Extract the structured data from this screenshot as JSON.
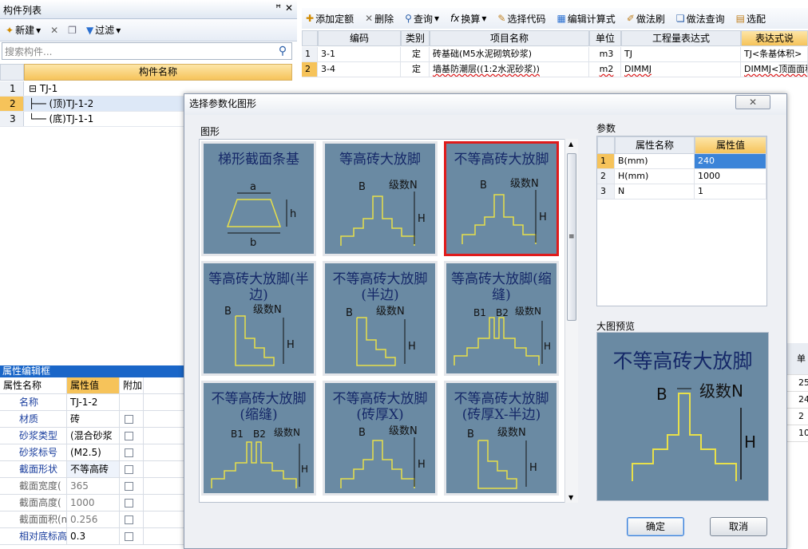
{
  "left_panel": {
    "title": "构件列表",
    "pin": "ꟸ",
    "close": "✕",
    "toolbar": {
      "new_label": "新建",
      "filter_label": "过滤"
    },
    "search_placeholder": "搜索构件...",
    "col_header": "构件名称",
    "rows": [
      {
        "num": "1",
        "text": "⊟ TJ-1"
      },
      {
        "num": "2",
        "text": "     ├── (顶)TJ-1-2"
      },
      {
        "num": "3",
        "text": "     └── (底)TJ-1-1"
      }
    ]
  },
  "prop_panel": {
    "title": "属性编辑框",
    "headers": [
      "属性名称",
      "属性值",
      "附加"
    ],
    "rows": [
      {
        "name": "名称",
        "value": "TJ-1-2"
      },
      {
        "name": "材质",
        "value": "砖"
      },
      {
        "name": "砂浆类型",
        "value": "(混合砂浆"
      },
      {
        "name": "砂浆标号",
        "value": "(M2.5)"
      },
      {
        "name": "截面形状",
        "value": "不等高砖"
      },
      {
        "name": "截面宽度(",
        "value": "365"
      },
      {
        "name": "截面高度(",
        "value": "1000"
      },
      {
        "name": "截面面积(m",
        "value": "0.256"
      },
      {
        "name": "相对底标高",
        "value": "0.3"
      }
    ]
  },
  "right_panel": {
    "toolbar": [
      "添加定额",
      "删除",
      "查询",
      "换算",
      "选择代码",
      "编辑计算式",
      "做法刷",
      "做法查询",
      "选配"
    ],
    "headers": [
      "",
      "编码",
      "类别",
      "项目名称",
      "单位",
      "工程量表达式",
      "表达式说"
    ],
    "rows": [
      [
        "1",
        "3-1",
        "定",
        "砖基础(M5水泥砌筑砂浆)",
        "m3",
        "TJ",
        "TJ<条基体积>"
      ],
      [
        "2",
        "3-4",
        "定",
        "墙基防潮层((1:2水泥砂浆))",
        "m2",
        "DIMMJ",
        "DIMMJ<顶面面积>"
      ]
    ]
  },
  "behind_cells": {
    "header": "单",
    "values": [
      "25",
      "24",
      "2",
      "10"
    ]
  },
  "dialog": {
    "title": "选择参数化图形",
    "close": "✕",
    "gallery_label": "图形",
    "tiles": [
      {
        "title": "梯形截面条基",
        "labels": [
          "a",
          "h",
          "b"
        ]
      },
      {
        "title": "等高砖大放脚",
        "labels": [
          "B",
          "级数N",
          "H"
        ]
      },
      {
        "title": "不等高砖大放脚",
        "labels": [
          "B",
          "级数N",
          "H"
        ]
      },
      {
        "title": "等高砖大放脚(半边)",
        "labels": [
          "B",
          "级数N",
          "H"
        ]
      },
      {
        "title": "不等高砖大放脚(半边)",
        "labels": [
          "B",
          "级数N",
          "H"
        ]
      },
      {
        "title": "等高砖大放脚(缩缝)",
        "labels": [
          "B1",
          "B2",
          "级数N",
          "H"
        ]
      },
      {
        "title": "不等高砖大放脚(缩缝)",
        "labels": [
          "B1",
          "B2",
          "级数N",
          "H"
        ]
      },
      {
        "title": "不等高砖大放脚(砖厚X)",
        "labels": [
          "B",
          "级数N",
          "H"
        ]
      },
      {
        "title": "不等高砖大放脚(砖厚X-半边)",
        "labels": [
          "B",
          "级数N",
          "H"
        ]
      }
    ],
    "params_label": "参数",
    "param_headers": [
      "属性名称",
      "属性值"
    ],
    "params": [
      {
        "num": "1",
        "name": "B(mm)",
        "value": "240"
      },
      {
        "num": "2",
        "name": "H(mm)",
        "value": "1000"
      },
      {
        "num": "3",
        "name": "N",
        "value": "1"
      }
    ],
    "preview_label": "大图预览",
    "preview": {
      "title": "不等高砖大放脚",
      "b": "B",
      "n": "级数N",
      "h": "H"
    },
    "ok": "确定",
    "cancel": "取消"
  }
}
